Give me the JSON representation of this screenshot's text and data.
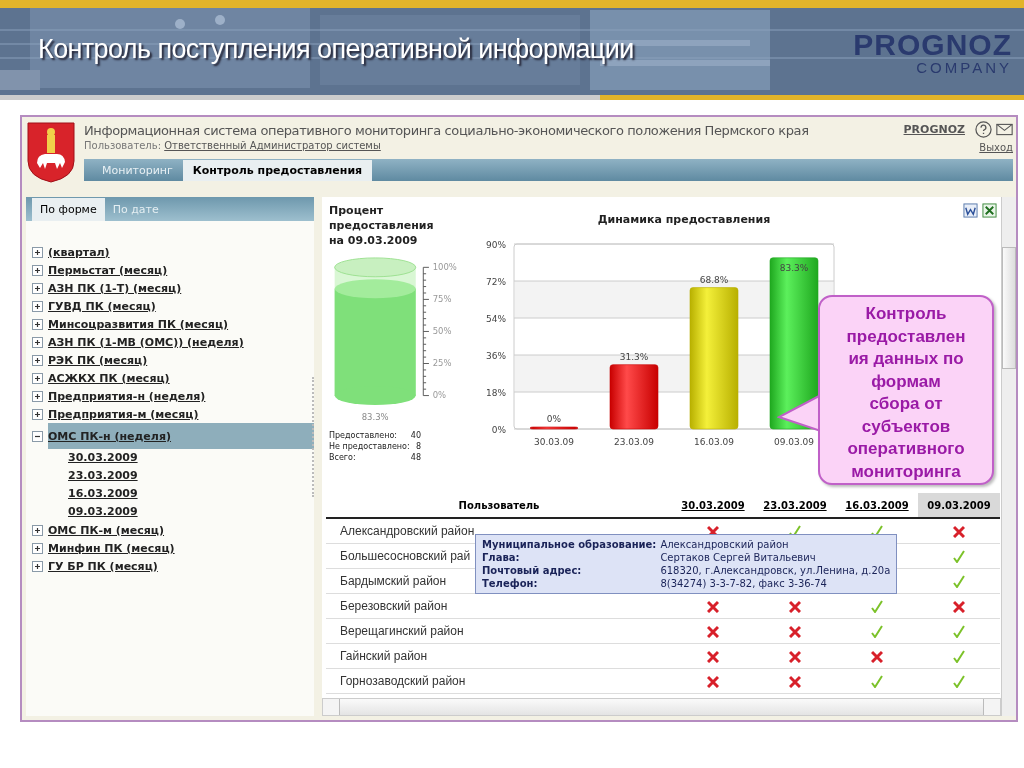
{
  "slide": {
    "title": "Контроль поступления оперативной информации",
    "logo": {
      "name": "PROGNOZ",
      "sub": "COMPANY"
    }
  },
  "app": {
    "title": "Информационная система оперативного мониторинга социально-экономического положения Пермского края",
    "user_label": "Пользователь:",
    "user": "Ответственный Администратор системы",
    "brand_link": "PROGNOZ",
    "logout": "Выход"
  },
  "tabs": [
    {
      "label": "Мониторинг",
      "selected": false
    },
    {
      "label": "Контроль предоставления",
      "selected": true
    }
  ],
  "sidebar": {
    "tabs": [
      {
        "label": "По форме",
        "selected": true
      },
      {
        "label": "По дате",
        "selected": false
      }
    ],
    "items": [
      {
        "label": "(квартал)",
        "expanded": false,
        "selected": false
      },
      {
        "label": "Пермьстат (месяц)",
        "expanded": false,
        "selected": false
      },
      {
        "label": "АЗН ПК (1-Т) (месяц)",
        "expanded": false,
        "selected": false
      },
      {
        "label": "ГУВД ПК (месяц)",
        "expanded": false,
        "selected": false
      },
      {
        "label": "Минсоцразвития ПК (месяц)",
        "expanded": false,
        "selected": false
      },
      {
        "label": "АЗН ПК (1-МВ (ОМС)) (неделя)",
        "expanded": false,
        "selected": false
      },
      {
        "label": "РЭК ПК (месяц)",
        "expanded": false,
        "selected": false
      },
      {
        "label": "АСЖКХ ПК (месяц)",
        "expanded": false,
        "selected": false
      },
      {
        "label": "Предприятия-н (неделя)",
        "expanded": false,
        "selected": false
      },
      {
        "label": "Предприятия-м (месяц)",
        "expanded": false,
        "selected": false
      },
      {
        "label": "ОМС ПК-н (неделя)",
        "expanded": true,
        "selected": true,
        "children": [
          {
            "label": "30.03.2009",
            "selected": false
          },
          {
            "label": "23.03.2009",
            "selected": false
          },
          {
            "label": "16.03.2009",
            "selected": false
          },
          {
            "label": "09.03.2009",
            "selected": false
          }
        ]
      },
      {
        "label": "ОМС ПК-м (месяц)",
        "expanded": false,
        "selected": false
      },
      {
        "label": "Минфин ПК (месяц)",
        "expanded": false,
        "selected": false
      },
      {
        "label": "ГУ БР ПК (месяц)",
        "expanded": false,
        "selected": false
      }
    ]
  },
  "gauge": {
    "title": "Процент предоставления на 09.03.2009",
    "reading": "83.3%",
    "ticks": [
      "100%",
      "75%",
      "50%",
      "25%",
      "0%"
    ],
    "stats": [
      {
        "label": "Предоставлено:",
        "value": "40"
      },
      {
        "label": "Не предоставлено:",
        "value": "8"
      },
      {
        "label": "Всего:",
        "value": "48"
      }
    ]
  },
  "chart": {
    "chart_data": {
      "type": "bar",
      "title": "Динамика предоставления",
      "categories": [
        "30.03.09",
        "23.03.09",
        "16.03.09",
        "09.03.09"
      ],
      "values": [
        0,
        31.3,
        68.8,
        83.3
      ],
      "grid": true,
      "ylim": [
        0,
        90
      ],
      "yticks": [
        {
          "value": 0,
          "label": "0%"
        },
        {
          "value": 18,
          "label": "18%"
        },
        {
          "value": 36,
          "label": "36%"
        },
        {
          "value": 54,
          "label": "54%"
        },
        {
          "value": 72,
          "label": "72%"
        },
        {
          "value": 90,
          "label": "90%"
        }
      ],
      "value_labels": [
        "0%",
        "31.3%",
        "68.8%",
        "83.3%"
      ]
    }
  },
  "table": {
    "columns": [
      {
        "label": "Пользователь",
        "selected": false
      },
      {
        "label": "30.03.2009",
        "selected": false
      },
      {
        "label": "23.03.2009",
        "selected": false
      },
      {
        "label": "16.03.2009",
        "selected": false
      },
      {
        "label": "09.03.2009",
        "selected": true
      }
    ],
    "rows": [
      {
        "name": "Александровский район",
        "cells": [
          {
            "submitted": false
          },
          {
            "submitted": true
          },
          {
            "submitted": true
          },
          {
            "submitted": false
          }
        ]
      },
      {
        "name": "Большесосновский рай",
        "cells": [
          {
            "covered": true
          },
          {
            "covered": true
          },
          {
            "covered": true
          },
          {
            "submitted": true
          }
        ]
      },
      {
        "name": "Бардымский район",
        "cells": [
          {
            "covered": true
          },
          {
            "covered": true
          },
          {
            "covered": true
          },
          {
            "submitted": true
          }
        ]
      },
      {
        "name": "Березовский район",
        "cells": [
          {
            "submitted": false
          },
          {
            "submitted": false
          },
          {
            "submitted": true
          },
          {
            "submitted": false
          }
        ]
      },
      {
        "name": "Верещагинский район",
        "cells": [
          {
            "submitted": false
          },
          {
            "submitted": false
          },
          {
            "submitted": true
          },
          {
            "submitted": true
          }
        ]
      },
      {
        "name": "Гайнский район",
        "cells": [
          {
            "submitted": false
          },
          {
            "submitted": false
          },
          {
            "submitted": false
          },
          {
            "submitted": true
          }
        ]
      },
      {
        "name": "Горнозаводский район",
        "cells": [
          {
            "submitted": false
          },
          {
            "submitted": false
          },
          {
            "submitted": true
          },
          {
            "submitted": true
          }
        ]
      }
    ]
  },
  "tooltip": {
    "rows": [
      {
        "label": "Муниципальное образование:",
        "value": "Александровский район"
      },
      {
        "label": "Глава:",
        "value": "Сертаков Сергей Витальевич"
      },
      {
        "label": "Почтовый адрес:",
        "value": "618320, г.Александровск, ул.Ленина, д.20а"
      },
      {
        "label": "Телефон:",
        "value": "8(34274) 3-3-7-82, факс 3-36-74"
      }
    ]
  },
  "callout": {
    "lines": [
      "Контроль",
      "предоставлен",
      "ия данных по",
      "формам",
      "сбора от",
      "субъектов",
      "оперативного",
      "мониторинга"
    ]
  }
}
